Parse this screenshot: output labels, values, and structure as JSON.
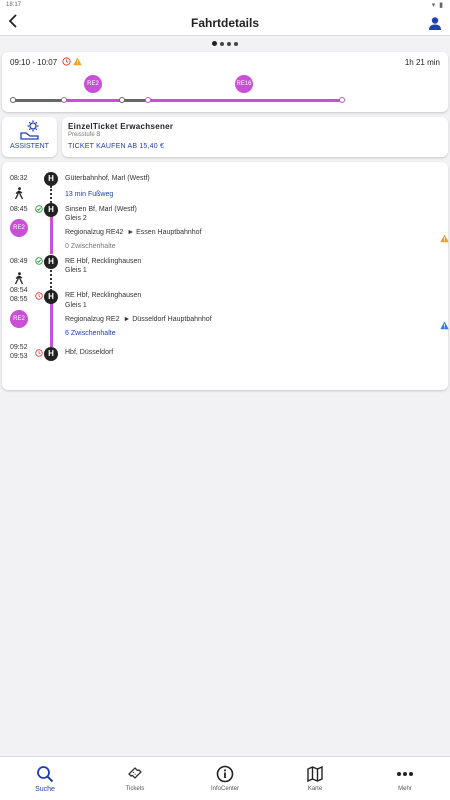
{
  "status": {
    "time": "18:17",
    "icons": "▾ ▮"
  },
  "header": {
    "title": "Fahrtdetails",
    "back_icon": "chevron-left-icon",
    "user_icon": "user-icon"
  },
  "pager": {
    "count": 4,
    "active": 0
  },
  "overview": {
    "times": "09:10 - 10:07",
    "duration": "1h 21 min",
    "lines": [
      {
        "label": "RE2"
      },
      {
        "label": "RE16"
      }
    ]
  },
  "assistant": {
    "label": "ASSISTENT"
  },
  "ticket": {
    "name": "EinzelTicket Erwachsener",
    "level": "Preisstufe B",
    "buy": "TICKET KAUFEN AB 15,40 €"
  },
  "journey": {
    "stop1": {
      "time": "08:32",
      "name": "Güterbahnhof, Marl (Westf)"
    },
    "walk": "13 min Fußweg",
    "stop2": {
      "time": "08:45",
      "name": "Sinsen Bf, Marl (Westf)",
      "platform": "Gleis 2"
    },
    "leg1": {
      "badge": "RE2",
      "line": "Regionalzug RE42",
      "direction": "► Essen Hauptbahnhof",
      "stops": "0 Zwischenhalte"
    },
    "stop3": {
      "time": "08:49",
      "name": "RE Hbf, Recklinghausen",
      "platform": "Gleis 1"
    },
    "stop4": {
      "time_arr": "08:54",
      "time_dep": "08:55",
      "name": "RE Hbf, Recklinghausen",
      "platform": "Gleis 1"
    },
    "leg2": {
      "badge": "RE2",
      "line": "Regionalzug RE2",
      "direction": "► Düsseldorf Hauptbahnhof",
      "stops": "6 Zwischenhalte"
    },
    "stop5": {
      "time_arr": "09:52",
      "time_dep": "09:53",
      "name": "Hbf, Düsseldorf"
    },
    "stop_marker": "H"
  },
  "colors": {
    "accent": "#2040b0",
    "line": "#c94fd6",
    "warning": "#f0a020",
    "info": "#2a7de1",
    "delay": "#e04040",
    "ontime": "#2a9a3a"
  },
  "nav": [
    {
      "label": "Suche",
      "icon": "search-icon"
    },
    {
      "label": "Tickets",
      "icon": "ticket-icon"
    },
    {
      "label": "InfoCenter",
      "icon": "info-icon"
    },
    {
      "label": "Karte",
      "icon": "map-icon"
    },
    {
      "label": "Mehr",
      "icon": "more-icon"
    }
  ]
}
